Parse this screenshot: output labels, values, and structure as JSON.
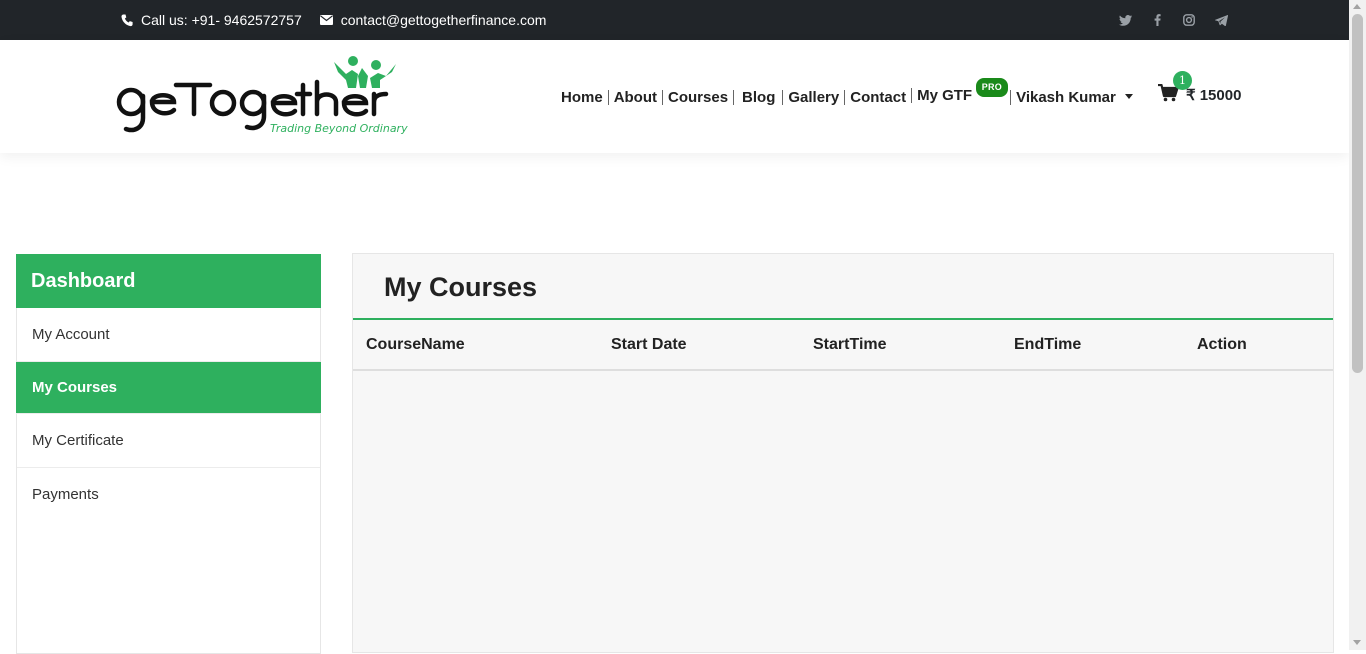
{
  "topbar": {
    "phone": "Call us: +91- 9462572757",
    "email": "contact@gettogetherfinance.com",
    "social": [
      "twitter-icon",
      "facebook-icon",
      "instagram-icon",
      "telegram-icon"
    ]
  },
  "brand": {
    "logo_text_dark": "geTogether",
    "tagline": "Trading Beyond Ordinary",
    "accent": "#2eb05e"
  },
  "nav": {
    "items": [
      "Home",
      "About",
      "Courses",
      "Blog",
      "Gallery",
      "Contact"
    ],
    "my_gtf": "My GTF",
    "pro_badge": "PRO",
    "user": "Vikash Kumar"
  },
  "cart": {
    "count": "1",
    "amount": "₹ 15000"
  },
  "sidebar": {
    "title": "Dashboard",
    "items": [
      {
        "label": "My Account",
        "active": false
      },
      {
        "label": "My Courses",
        "active": true
      },
      {
        "label": "My Certificate",
        "active": false
      },
      {
        "label": "Payments",
        "active": false
      }
    ]
  },
  "main": {
    "title": "My Courses",
    "columns": [
      "CourseName",
      "Start Date",
      "StartTime",
      "EndTime",
      "Action"
    ],
    "rows": []
  }
}
